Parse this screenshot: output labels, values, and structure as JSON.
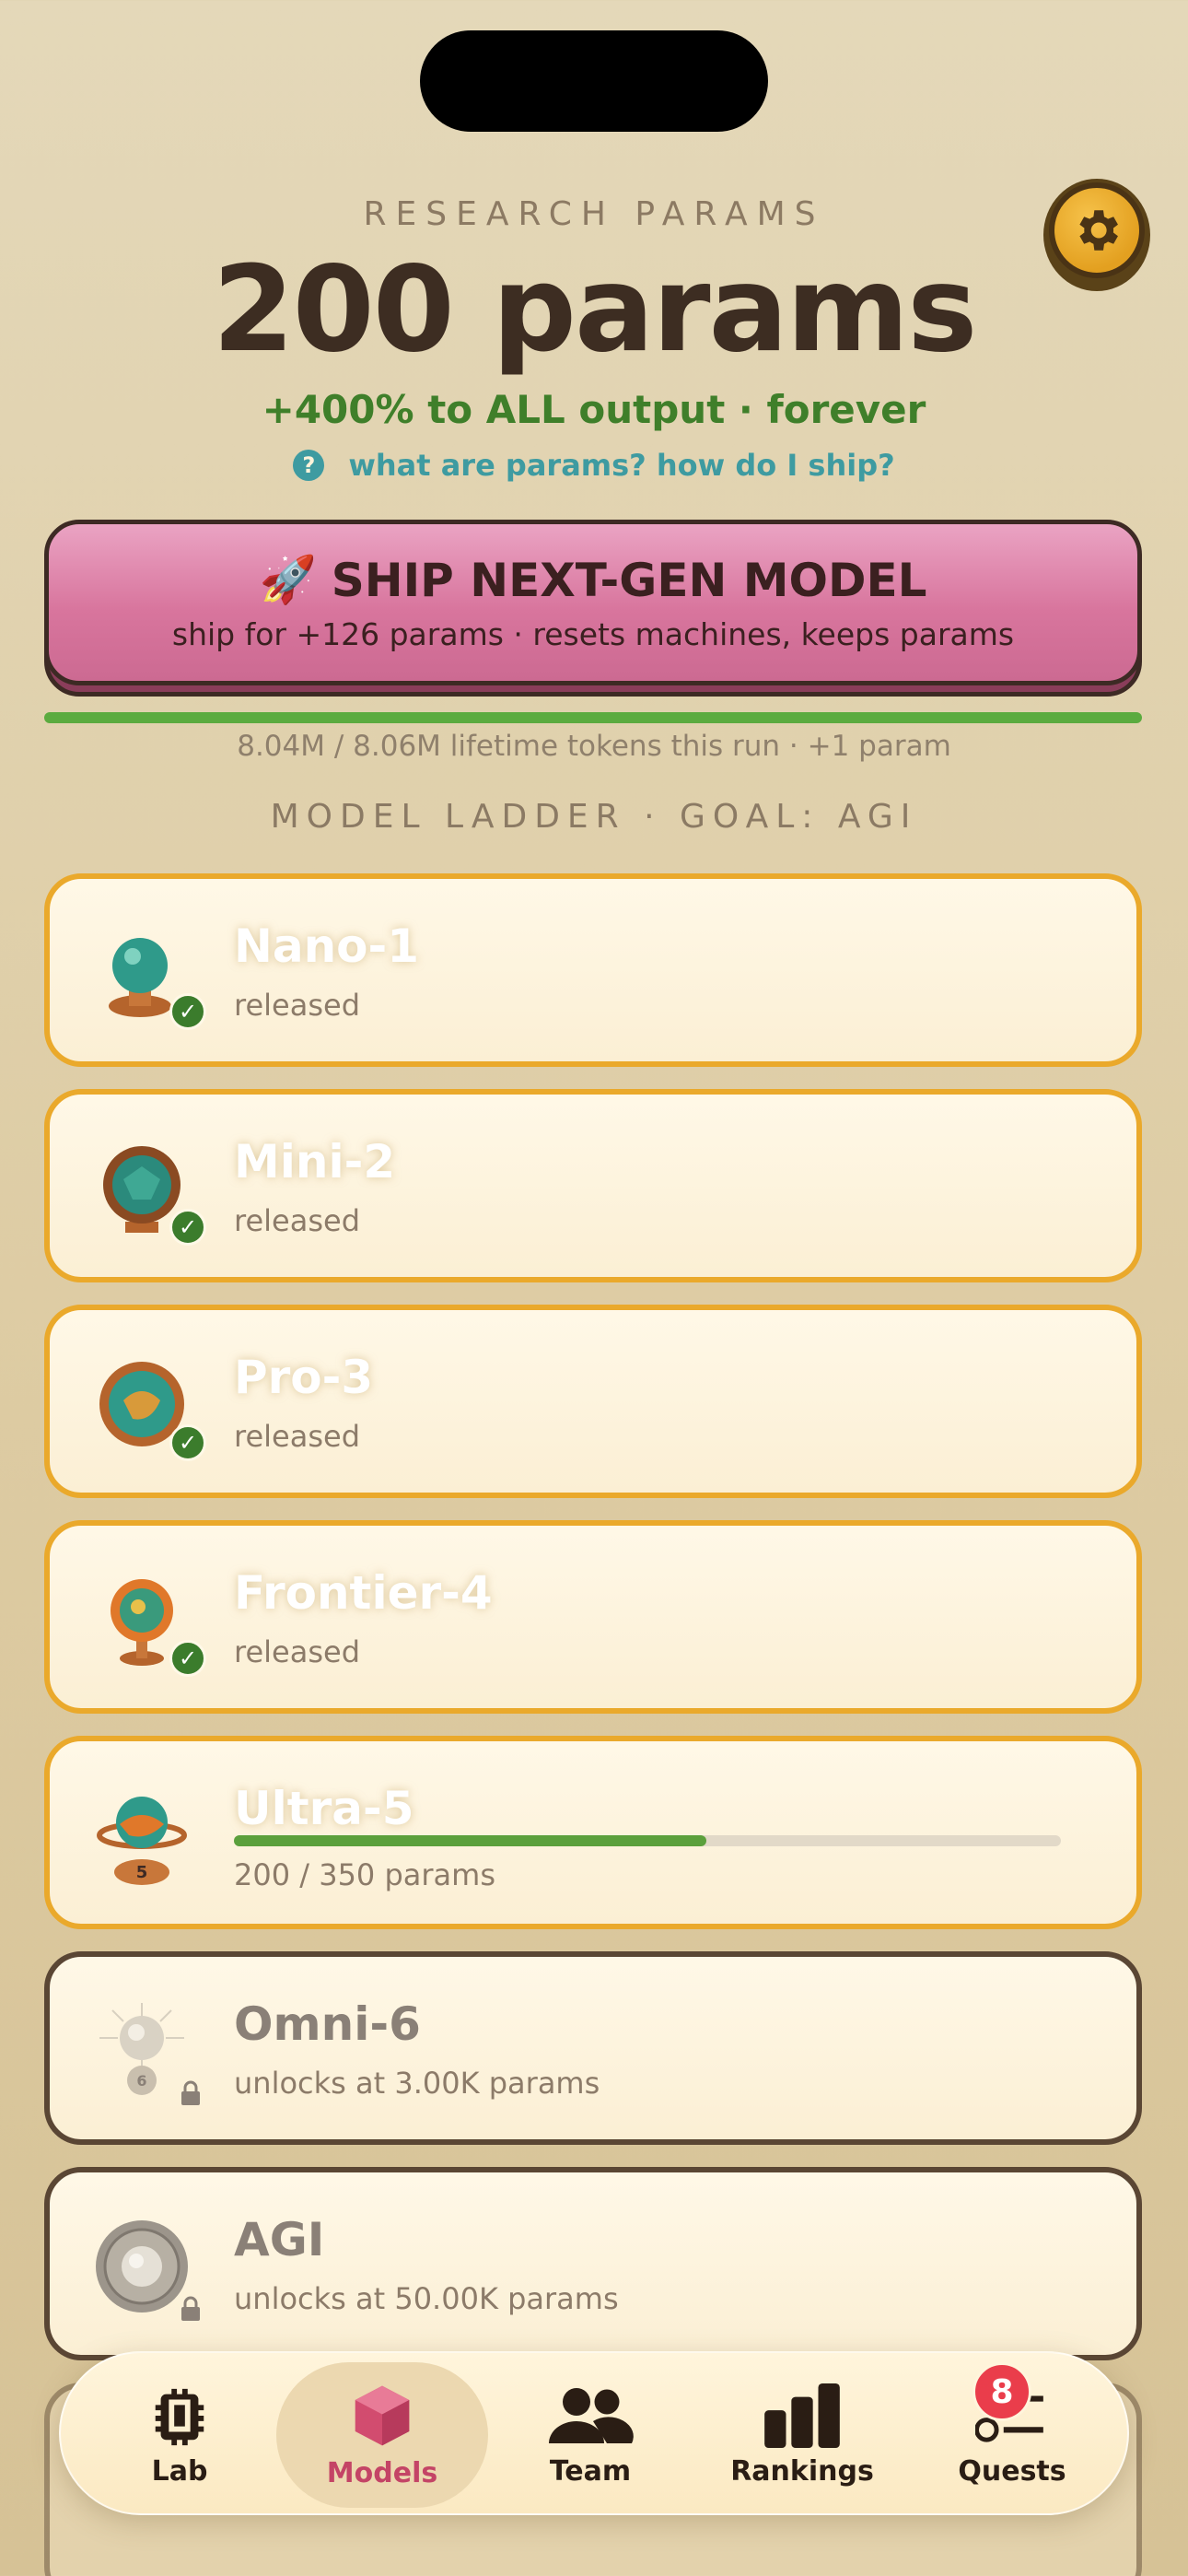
{
  "header": {
    "eyebrow": "RESEARCH PARAMS",
    "params": "200 params",
    "bonus": "+400% to ALL output · forever",
    "help_icon": "?",
    "help_link": "what are params? how do I ship?"
  },
  "ship": {
    "emoji": "🚀",
    "title": "SHIP NEXT-GEN MODEL",
    "subtitle": "ship for +126 params · resets machines, keeps params",
    "lifetime": "8.04M / 8.06M lifetime tokens this run  ·  +1 param",
    "lifetime_progress": 0.997
  },
  "ladder": {
    "title": "MODEL LADDER · GOAL: AGI",
    "models": [
      {
        "name": "Nano-1",
        "status": "released",
        "icon": "globe-small-icon"
      },
      {
        "name": "Mini-2",
        "status": "released",
        "icon": "globe-frame-icon"
      },
      {
        "name": "Pro-3",
        "status": "released",
        "icon": "globe-ring-icon"
      },
      {
        "name": "Frontier-4",
        "status": "released",
        "icon": "globe-flame-icon"
      },
      {
        "name": "Ultra-5",
        "status": "200 / 350 params",
        "progress": 0.571,
        "icon": "globe-trophy-icon"
      },
      {
        "name": "Omni-6",
        "status": "unlocks at 3.00K params",
        "icon": "orb-6-icon"
      },
      {
        "name": "AGI",
        "status": "unlocks at 50.00K params",
        "icon": "orb-agi-icon"
      }
    ]
  },
  "tabs": {
    "lab": "Lab",
    "models": "Models",
    "team": "Team",
    "rankings": "Rankings",
    "quests": "Quests",
    "quests_badge": "8"
  },
  "colors": {
    "accent_pink": "#d8759d",
    "gold_border": "#eaa92b",
    "progress_green": "#5ba03c",
    "badge_red": "#ea3d4b"
  }
}
